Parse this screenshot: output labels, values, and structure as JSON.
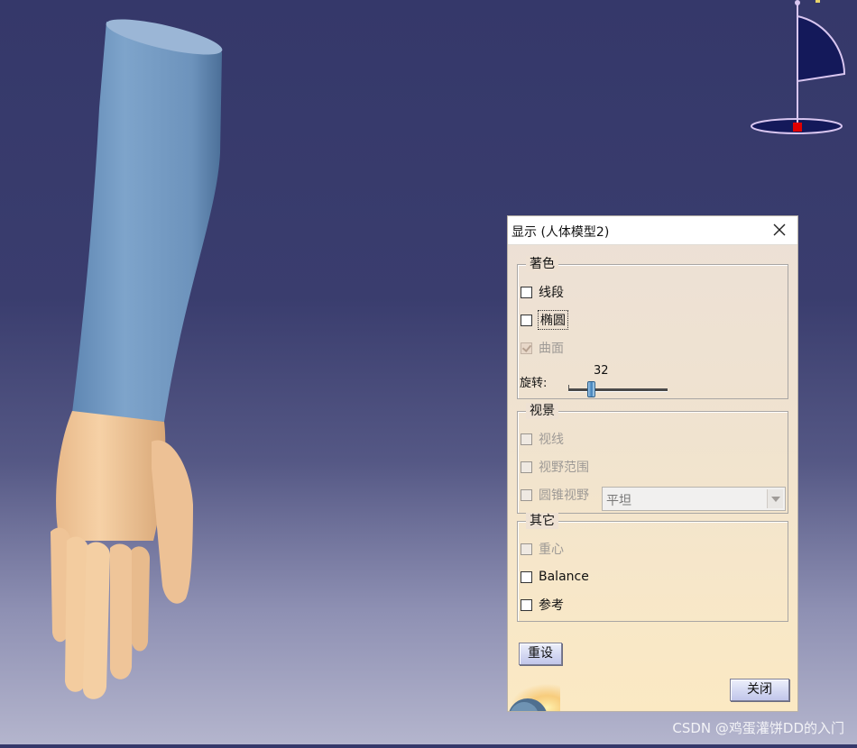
{
  "dialog": {
    "title": "显示 (人体模型2)",
    "groups": {
      "shading": {
        "legend": "著色",
        "segments": {
          "label": "线段",
          "checked": false,
          "enabled": true
        },
        "ellipse": {
          "label": "椭圆",
          "checked": false,
          "enabled": true,
          "focused": true
        },
        "surface": {
          "label": "曲面",
          "checked": true,
          "enabled": false
        },
        "rotation": {
          "label": "旋转:",
          "value": "32",
          "value_num": 32,
          "max": 360
        }
      },
      "vision": {
        "legend": "视景",
        "line_of_sight": {
          "label": "视线",
          "checked": false,
          "enabled": false
        },
        "field_of_view": {
          "label": "视野范围",
          "checked": false,
          "enabled": false
        },
        "cone": {
          "label": "圆锥视野",
          "checked": false,
          "enabled": false
        },
        "cone_mode": {
          "selected": "平坦"
        }
      },
      "other": {
        "legend": "其它",
        "center_of_gravity": {
          "label": "重心",
          "checked": false,
          "enabled": false
        },
        "balance": {
          "label": "Balance",
          "checked": false,
          "enabled": true
        },
        "reference": {
          "label": "参考",
          "checked": false,
          "enabled": true
        }
      }
    },
    "reset_label": "重设",
    "close_label": "关闭"
  },
  "watermark": "CSDN @鸡蛋灌饼DD的入门",
  "colors": {
    "background_top": "#35386a",
    "background_bottom": "#b4b5cd",
    "sleeve": "#7197bf",
    "skin": "#f0c79a",
    "dialog_bg": "#f0e3cf",
    "compass_fill": "#14195a",
    "compass_line": "#d9c6f0",
    "compass_marker": "#e00000"
  }
}
